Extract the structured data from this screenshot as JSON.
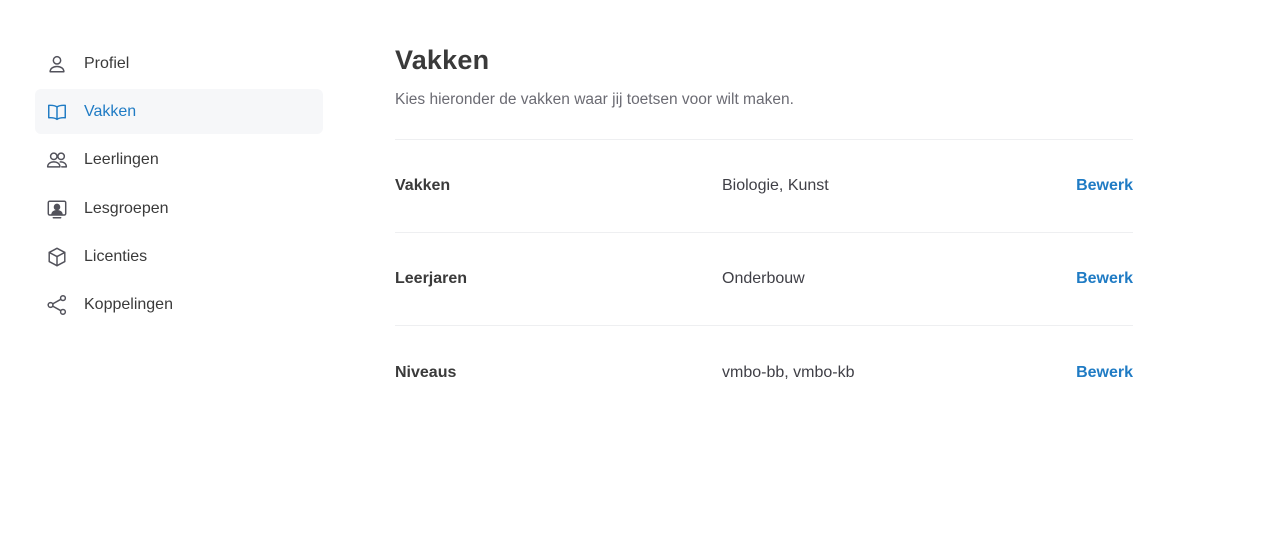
{
  "sidebar": {
    "items": [
      {
        "label": "Profiel",
        "icon": "user-icon",
        "active": false
      },
      {
        "label": "Vakken",
        "icon": "book-open-icon",
        "active": true
      },
      {
        "label": "Leerlingen",
        "icon": "users-icon",
        "active": false
      },
      {
        "label": "Lesgroepen",
        "icon": "presentation-icon",
        "active": false
      },
      {
        "label": "Licenties",
        "icon": "cube-icon",
        "active": false
      },
      {
        "label": "Koppelingen",
        "icon": "share-icon",
        "active": false
      }
    ]
  },
  "main": {
    "title": "Vakken",
    "subtitle": "Kies hieronder de vakken waar jij toetsen voor wilt maken.",
    "rows": [
      {
        "label": "Vakken",
        "value": "Biologie, Kunst",
        "action": "Bewerk"
      },
      {
        "label": "Leerjaren",
        "value": "Onderbouw",
        "action": "Bewerk"
      },
      {
        "label": "Niveaus",
        "value": "vmbo-bb, vmbo-kb",
        "action": "Bewerk"
      }
    ]
  },
  "colors": {
    "accent": "#1f7bc4",
    "active_bg": "#f6f7f9",
    "divider": "#eeeff1",
    "text": "#3a3a3a",
    "muted": "#6b6b73"
  }
}
